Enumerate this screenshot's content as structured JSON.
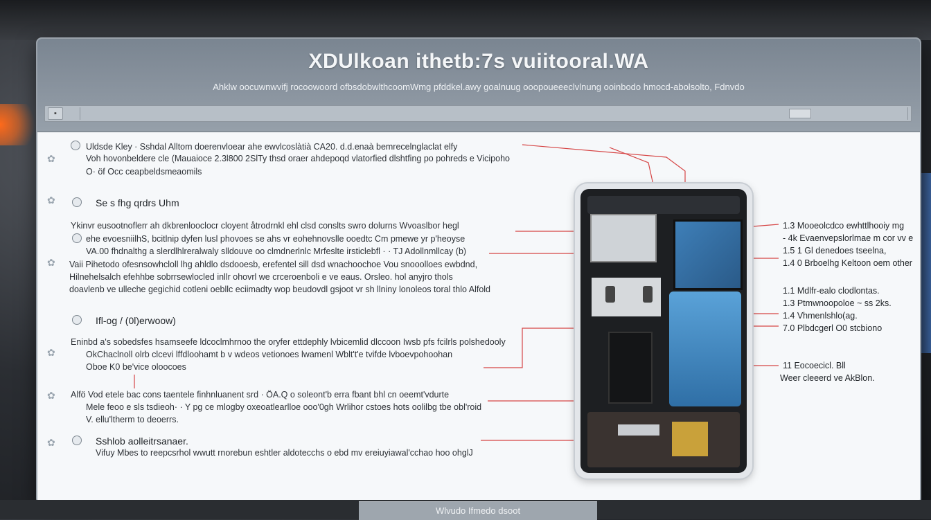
{
  "window": {
    "title": "XDUlkoan ithetb:7s vuiitooral.WA",
    "subtitle": "Ahklw oocuwnwvifj rocoowoord ofbsdobwlthcoomWmg pfddkel.awy goalnuug ooopoueeeclvlnung ooinbodo hmocd-abolsolto, Fdnvdo"
  },
  "text_blocks": {
    "intro": [
      "Uldsde Kley · Sshdal Alltom doerenvloear ahe ewvlcoslàtià CA20. d.d.enaà bemrecelnglaclat elfy",
      "Voh hovonbeldere cle (Mauaioce 2.3l800 2SlTy thsd oraer ahdepoqd vlatorfied dlshtfing po pohreds e Vicipoho",
      "O· öf Occ ceapbeldsmeaomils"
    ],
    "section1_heading": "Se s fhg qrdrs Uhm",
    "section1": [
      "Ykinvr eusootnoflerr ah dkbrenlooclocr cloyent åtrodrnkl ehl clsd conslts swro dolurns Wvoaslbor hegl",
      "ehe evoesniilhS, bcitlnip dyfen lusl phovoes se ahs vr eohehnovslle ooedtc Cm pmewe yr p'heoyse",
      "VA.00 fhdnalthg a slerdlhlreralwaly slldouve oo clmdnerlnlc Mrfeslte irsticlebfl · · TJ Adollnmllcay (b)",
      "Vaii Pihetodo ofesnsowhcloll lhg ahldlo dsdooesb, erefentel sill dsd wnachoochoe Vou snooolloes ewbdnd,",
      "Hilnehelsalch efehhbe sobrrsewlocled inllr ohovrl we crceroenboli e ve eaus. Orsleo. hol anyjro thols",
      "doavlenb ve ulleche gegichid cotleni oebllc eciimadty wop beudovdl gsjoot vr sh llniny lonoleos toral thlo Alfold"
    ],
    "section2_heading": "Ifl-og / (0l)erwoow)",
    "section2": [
      "Eninbd a's sobedsfes hsamseefe ldcoclmhrnoo the oryfer ettdephly lvbicemlid dlccoon Iwsb pfs fcilrls polshedooly",
      "OkChaclnoll olrb clcevi lffdloohamt b v wdeos vetionoes lwamenl Wblt't'e tvifde lvboevpohoohan",
      "Oboe K0 be'vice oloocoes"
    ],
    "section3": [
      "Alfö Vod etele bac cons taentele finhnluanent srd · ÖA.Q o soleont'b erra fbant bhl cn oeemt'vdurte",
      "Mele feoo e sls tsdieoh· · Y pg ce mlogby oxeoatlearlloe ooo'0gh Wrlihor cstoes hots oolilbg tbe obl'roid",
      "V. ellu'ltherm to deoerrs."
    ],
    "section4_heading": "Sshlob aolleitrsanaer.",
    "section4": [
      "Vifuy Mbes to reepcsrhol wwutt rnorebun eshtler aldotecchs o ebd mv ereiuyiawal'cchao hoo ohglJ"
    ]
  },
  "callouts": {
    "group1": [
      "1.3 Mooeolcdco ewhttlhooiy mg",
      "- 4k Evaenvepslorlmae m cor vv e",
      "1.5 1 Gl denedoes tseelna,",
      "1.4 0 Brboelhg Keltoon oem other"
    ],
    "group2": [
      "1.1 Mdlfr-ealo clodlontas.",
      "1.3 Ptmwnoopoloe ~ ss 2ks.",
      "1.4 Vhmenlshlo(ag.",
      "7.0 Plbdcgerl O0 stcbiono"
    ],
    "group3": [
      "11 Eocoecicl. Bll",
      "Weer cleeerd ve AkBlon."
    ]
  },
  "status": {
    "label": "Wlvudo Ifmedo dsoot"
  }
}
